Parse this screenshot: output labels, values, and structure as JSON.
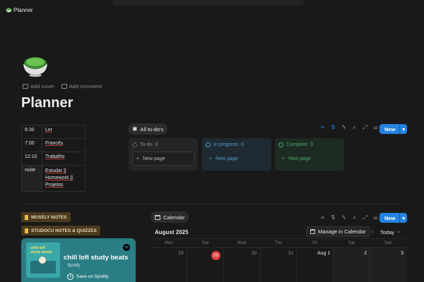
{
  "app": {
    "tab_title": "Planner"
  },
  "page": {
    "title": "Planner",
    "add_cover": "Add cover",
    "add_comment": "Add comment"
  },
  "schedule": [
    {
      "time": "6:30",
      "activity": "Ler"
    },
    {
      "time": "7:00",
      "activity": "Francês"
    },
    {
      "time": "12:10",
      "activity": "Trabalho"
    },
    {
      "time": "noite",
      "activity": "Estudar || Homework || Projetos"
    }
  ],
  "todo_board": {
    "view_label": "All to-do's",
    "new_label": "New",
    "columns": [
      {
        "name": "To-do",
        "count": "0",
        "new_page": "New page",
        "color": "#8a8a8a",
        "bg": "#252525"
      },
      {
        "name": "In progress",
        "count": "0",
        "new_page": "New page",
        "color": "#529cca",
        "bg": "#1f2a33"
      },
      {
        "name": "Complete",
        "count": "0",
        "new_page": "New page",
        "color": "#4dab6f",
        "bg": "#1e2b23"
      }
    ]
  },
  "links": {
    "musely": "MUSELY NOTES",
    "studocu": "STUDOCU NOTES & QUIZZES"
  },
  "spotify": {
    "title": "chill lofi study beats",
    "cover_text": "chill lofi study beats",
    "source": "Spotify",
    "save_label": "Save on Spotify"
  },
  "calendar": {
    "view_label": "Calendar",
    "new_label": "New",
    "month": "August 2025",
    "manage_label": "Manage in Calendar",
    "today_label": "Today",
    "weekdays": [
      "Mon",
      "Tue",
      "Wed",
      "Thu",
      "Fri",
      "Sat",
      "Sun"
    ],
    "days": [
      "28",
      "29",
      "30",
      "31",
      "Aug 1",
      "2",
      "3"
    ]
  },
  "colors": {
    "accent": "#2383e2",
    "today": "#e03e3e",
    "link_pill": "#4a3a1e"
  }
}
